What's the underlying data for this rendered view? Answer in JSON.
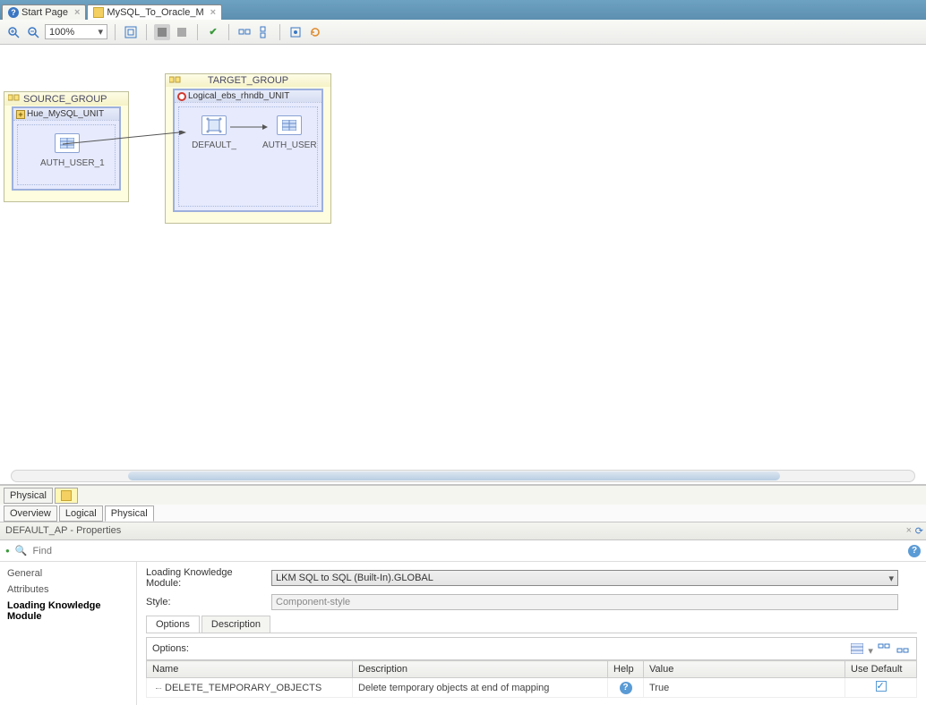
{
  "tabs_top": {
    "start": "Start Page",
    "mapping": "MySQL_To_Oracle_M"
  },
  "toolbar": {
    "zoom": "100%"
  },
  "diagram": {
    "source_group": "SOURCE_GROUP",
    "source_unit": "Hue_MySQL_UNIT",
    "source_node": "AUTH_USER_1",
    "target_group": "TARGET_GROUP",
    "target_unit": "Logical_ebs_rhndb_UNIT",
    "target_node1": "DEFAULT_",
    "target_node2": "AUTH_USER"
  },
  "diag_tabs": {
    "physical": "Physical"
  },
  "subtabs": {
    "overview": "Overview",
    "logical": "Logical",
    "physical": "Physical"
  },
  "props": {
    "title": "DEFAULT_AP - Properties",
    "find_placeholder": "Find"
  },
  "cats": {
    "general": "General",
    "attributes": "Attributes",
    "lkm": "Loading Knowledge Module"
  },
  "form": {
    "lkm_label": "Loading Knowledge Module:",
    "lkm_value": "LKM SQL to SQL (Built-In).GLOBAL",
    "style_label": "Style:",
    "style_value": "Component-style"
  },
  "opt_tabs": {
    "options": "Options",
    "description": "Description"
  },
  "opt": {
    "title": "Options:",
    "cols": {
      "name": "Name",
      "desc": "Description",
      "help": "Help",
      "value": "Value",
      "usedef": "Use Default"
    },
    "row1": {
      "name": "DELETE_TEMPORARY_OBJECTS",
      "desc": "Delete temporary objects at end of mapping",
      "value": "True"
    }
  }
}
